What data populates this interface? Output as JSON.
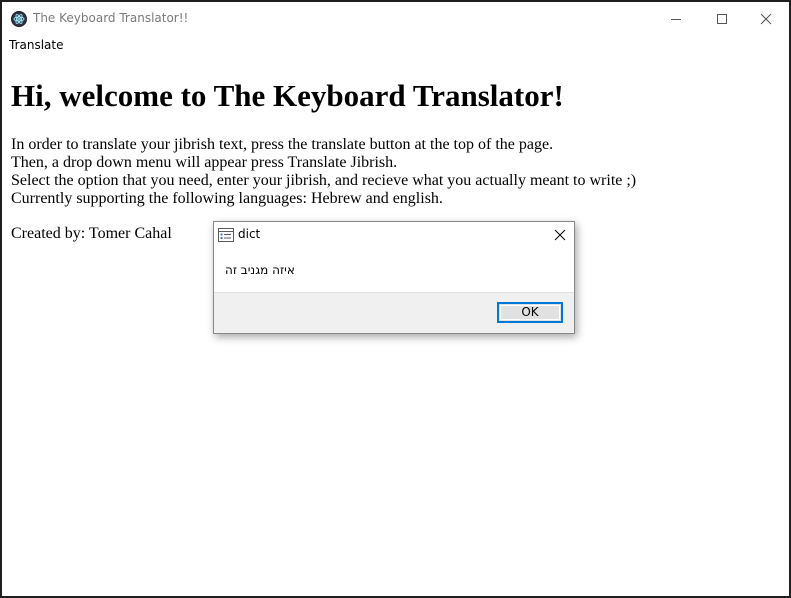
{
  "window": {
    "title": "The Keyboard Translator!!",
    "icon": "electron-app-icon"
  },
  "menubar": {
    "items": [
      {
        "label": "Translate"
      }
    ]
  },
  "content": {
    "heading": "Hi, welcome to The Keyboard Translator!",
    "intro_lines": [
      "In order to translate your jibrish text, press the translate button at the top of the page.",
      "Then, a drop down menu will appear press Translate Jibrish.",
      "Select the option that you need, enter your jibrish, and recieve what you actually meant to write ;)",
      "Currently supporting the following languages: Hebrew and english."
    ],
    "credit": "Created by: Tomer Cahal"
  },
  "dialog": {
    "title": "dict",
    "message": "איזה מגניב זה",
    "ok_label": "OK"
  },
  "colors": {
    "accent": "#0078d7",
    "dialog_footer": "#f0f0f0",
    "title_text": "#7a7a7a"
  }
}
